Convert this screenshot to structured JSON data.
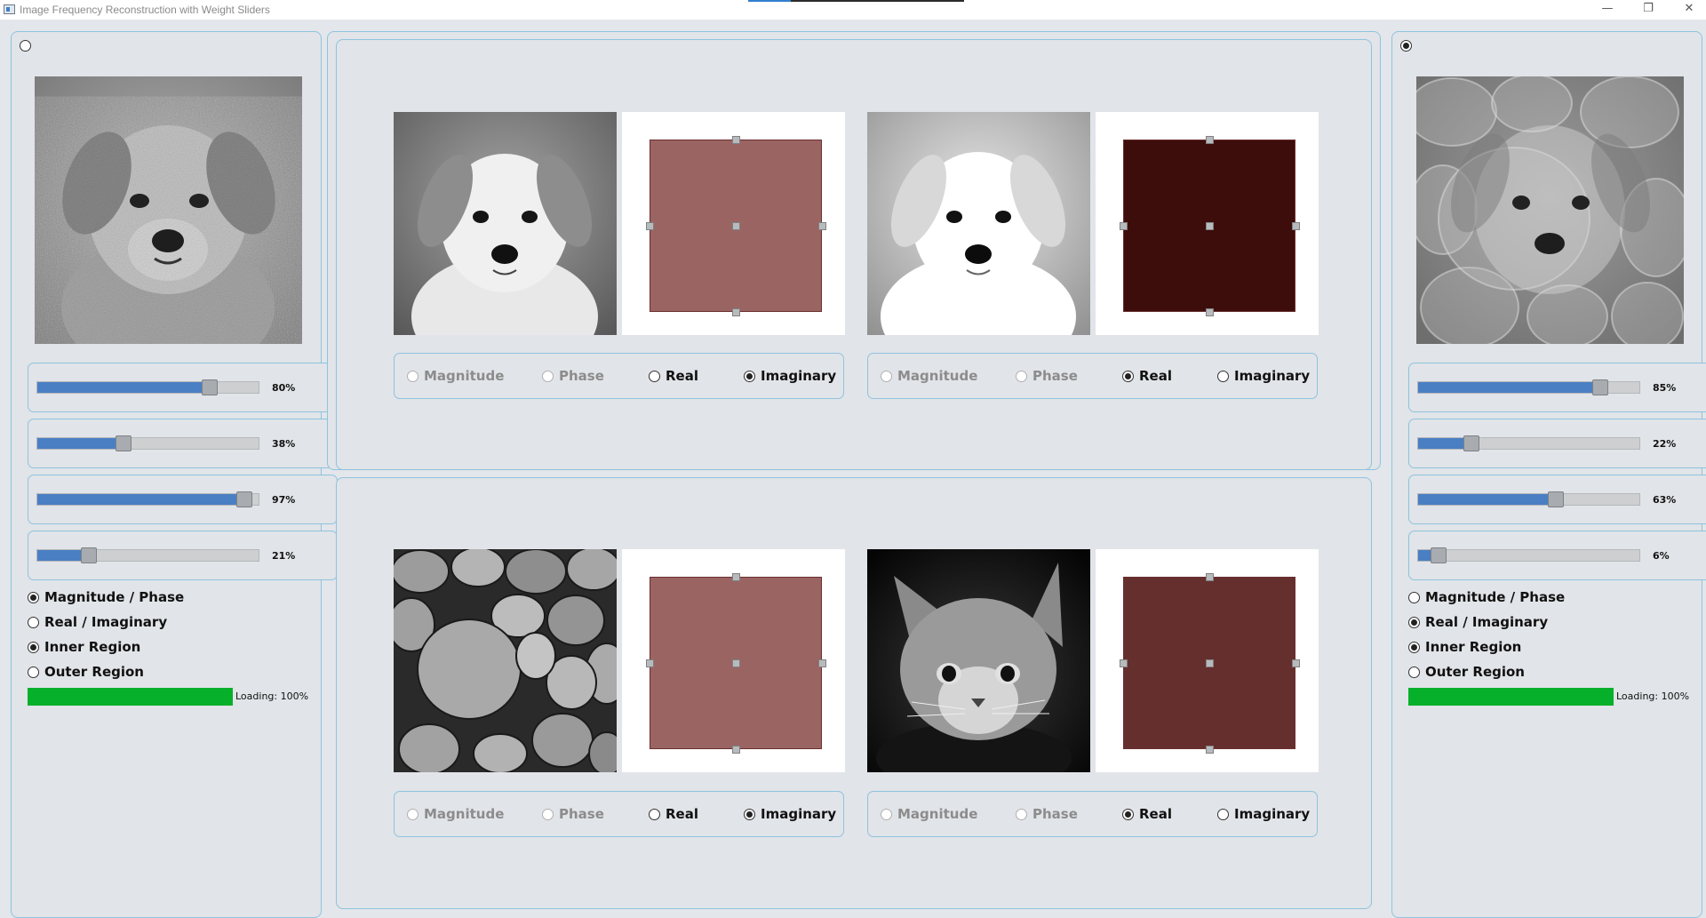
{
  "window": {
    "title": "Image Frequency Reconstruction with Weight Sliders",
    "minimize_glyph": "—",
    "restore_glyph": "❐",
    "close_glyph": "✕"
  },
  "left_output": {
    "selected": false,
    "image": "puppy-reconstruction-grainy",
    "sliders": [
      {
        "value": 0.8,
        "label": "80%"
      },
      {
        "value": 0.38,
        "label": "38%"
      },
      {
        "value": 0.97,
        "label": "97%"
      },
      {
        "value": 0.21,
        "label": "21%"
      }
    ],
    "options": [
      {
        "label": "Magnitude / Phase",
        "checked": true
      },
      {
        "label": "Real / Imaginary",
        "checked": false
      },
      {
        "label": "Inner Region",
        "checked": true
      },
      {
        "label": "Outer Region",
        "checked": false
      }
    ],
    "progress": {
      "value": 1.0,
      "label": "Loading: 100%"
    }
  },
  "right_output": {
    "selected": true,
    "image": "puppy-reconstruction-blended",
    "sliders": [
      {
        "value": 0.85,
        "label": "85%"
      },
      {
        "value": 0.22,
        "label": "22%"
      },
      {
        "value": 0.63,
        "label": "63%"
      },
      {
        "value": 0.06,
        "label": "6%"
      }
    ],
    "options": [
      {
        "label": "Magnitude / Phase",
        "checked": false
      },
      {
        "label": "Real / Imaginary",
        "checked": true
      },
      {
        "label": "Inner Region",
        "checked": true
      },
      {
        "label": "Outer Region",
        "checked": false
      }
    ],
    "progress": {
      "value": 1.0,
      "label": "Loading: 100%"
    }
  },
  "inputs": [
    {
      "image": "puppy-grayscale",
      "ft_color": "#9a6462",
      "modes": [
        {
          "label": "Magnitude",
          "enabled": false,
          "checked": false
        },
        {
          "label": "Phase",
          "enabled": false,
          "checked": false
        },
        {
          "label": "Real",
          "enabled": true,
          "checked": false
        },
        {
          "label": "Imaginary",
          "enabled": true,
          "checked": true
        }
      ]
    },
    {
      "image": "puppy-bright",
      "ft_color": "#3c0d0b",
      "modes": [
        {
          "label": "Magnitude",
          "enabled": false,
          "checked": false
        },
        {
          "label": "Phase",
          "enabled": false,
          "checked": false
        },
        {
          "label": "Real",
          "enabled": true,
          "checked": true
        },
        {
          "label": "Imaginary",
          "enabled": true,
          "checked": false
        }
      ]
    },
    {
      "image": "pebbles",
      "ft_color": "#9a6462",
      "modes": [
        {
          "label": "Magnitude",
          "enabled": false,
          "checked": false
        },
        {
          "label": "Phase",
          "enabled": false,
          "checked": false
        },
        {
          "label": "Real",
          "enabled": true,
          "checked": false
        },
        {
          "label": "Imaginary",
          "enabled": true,
          "checked": true
        }
      ]
    },
    {
      "image": "kitten",
      "ft_color": "#652f2e",
      "modes": [
        {
          "label": "Magnitude",
          "enabled": false,
          "checked": false
        },
        {
          "label": "Phase",
          "enabled": false,
          "checked": false
        },
        {
          "label": "Real",
          "enabled": true,
          "checked": true
        },
        {
          "label": "Imaginary",
          "enabled": true,
          "checked": false
        }
      ]
    }
  ]
}
